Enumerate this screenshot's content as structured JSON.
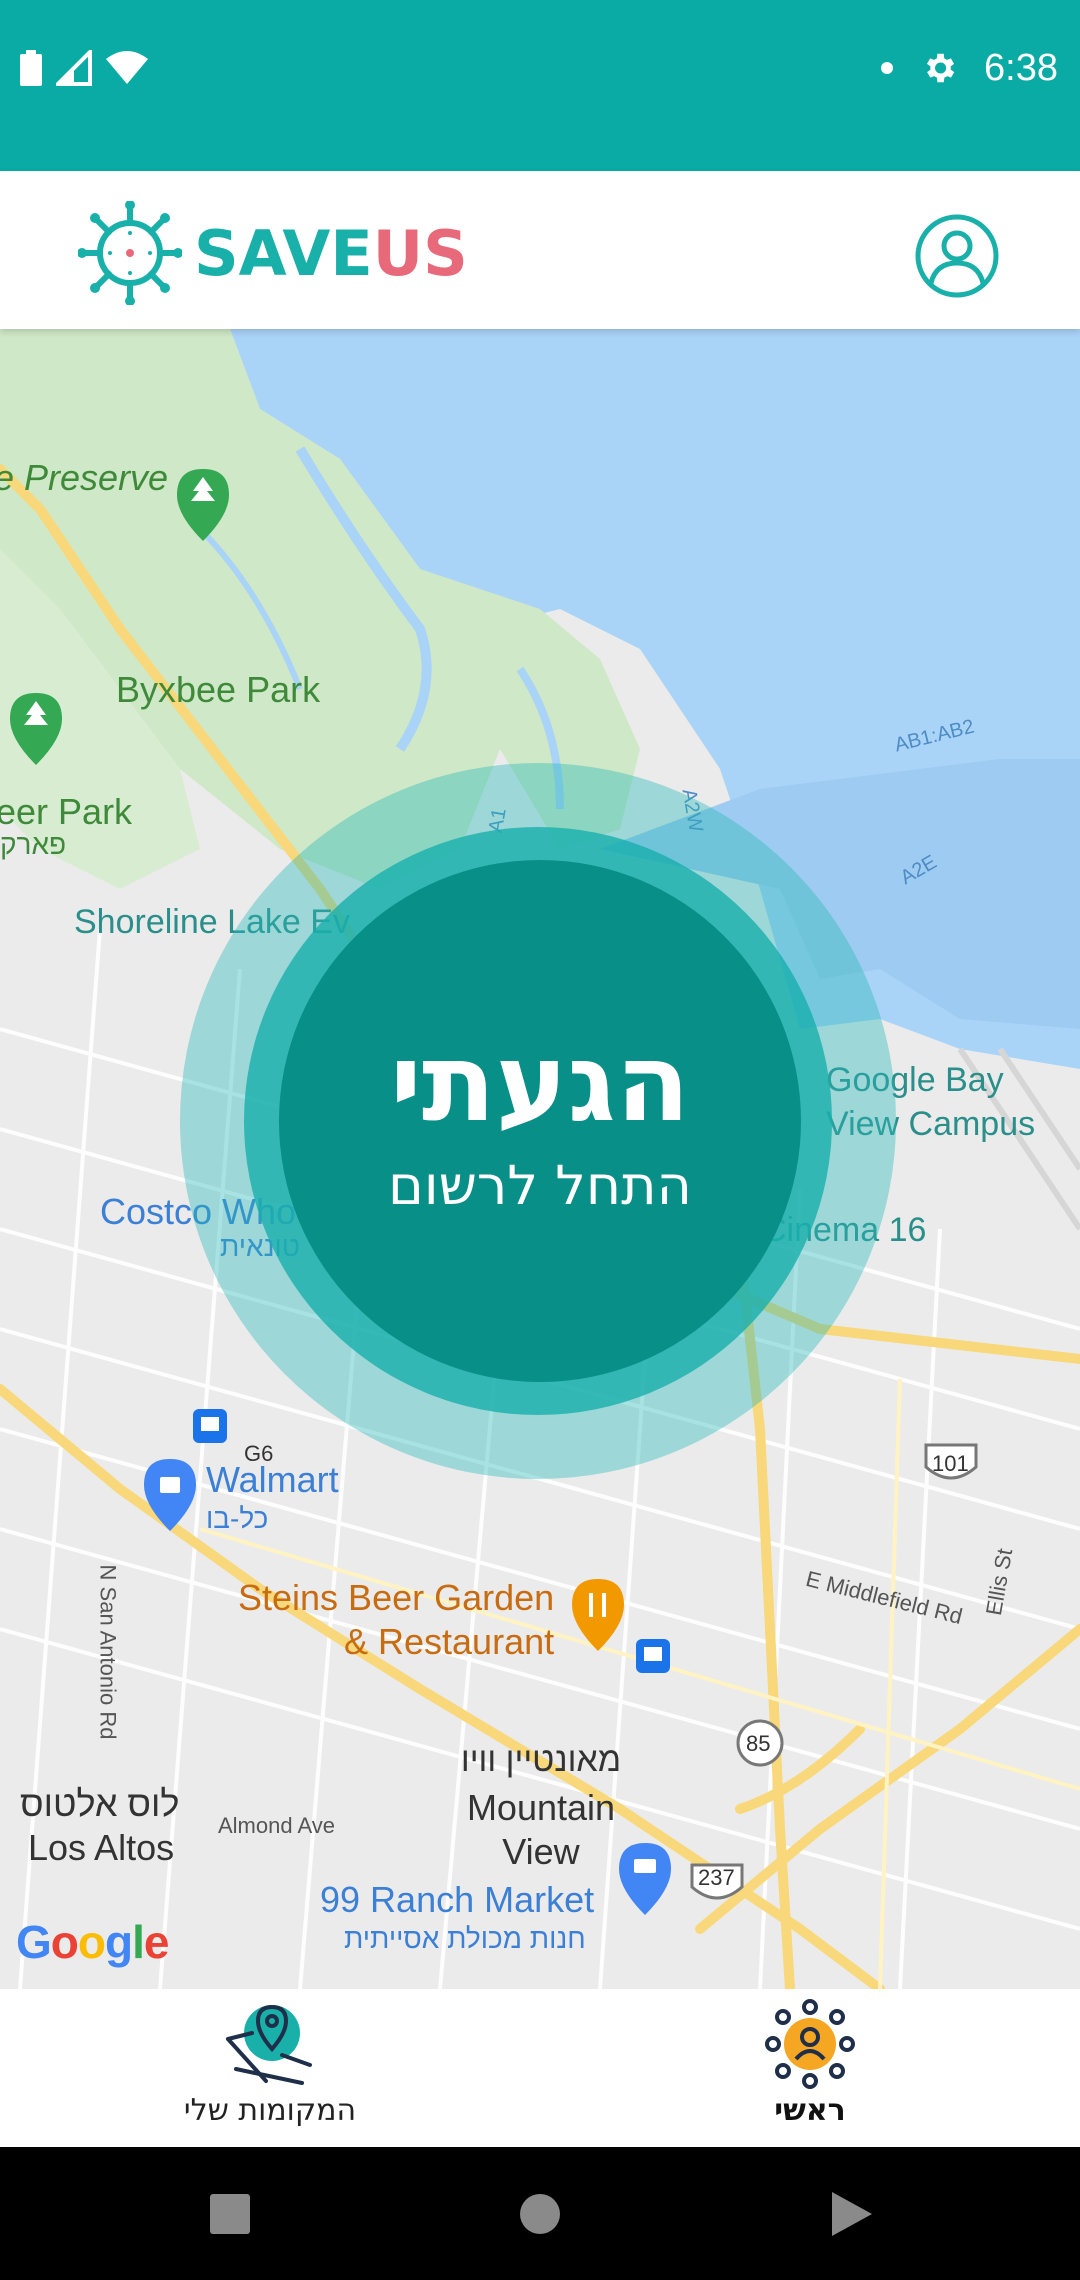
{
  "status_bar": {
    "time": "6:38",
    "icons": [
      "battery-icon",
      "signal-icon",
      "wifi-icon",
      "notification-dot-icon",
      "settings-icon"
    ]
  },
  "header": {
    "brand_part1": "SAVE",
    "brand_part2": "US",
    "logo_icon": "virus-icon",
    "profile_icon": "user-circle-icon"
  },
  "colors": {
    "primary": "#0aaba4",
    "brand_teal": "#1ab0aa",
    "brand_pink": "#e8697a",
    "button_fill": "#088f88",
    "accent_orange": "#f5a623"
  },
  "map": {
    "labels": {
      "preserve": "e Preserve",
      "byxbee": "Byxbee Park",
      "eer_park": "eer Park",
      "eer_park_he": "פארק",
      "shoreline": "Shoreline Lake Ev",
      "costco": "Costco Who",
      "costco_he": "טונאית",
      "google_bay_1": "Google Bay",
      "google_bay_2": "View Campus",
      "cinema": "Cinema 16",
      "walmart": "Walmart",
      "walmart_he": "כל-בו",
      "g6": "G6",
      "steins_1": "Steins Beer Garden",
      "steins_2": "& Restaurant",
      "mv_he": "מאונטיין וויו",
      "mv_1": "Mountain",
      "mv_2": "View",
      "los_altos_he": "לוס אלטוס",
      "los_altos": "Los Altos",
      "almond": "Almond Ave",
      "ranch": "99 Ranch Market",
      "ranch_he": "חנות מכולת אסייתית",
      "middlefield": "E Middlefield Rd",
      "ellis": "Ellis St",
      "antonio": "N San Antonio Rd",
      "ab1": "AB1:AB2",
      "a2e": "A2E",
      "a1": "A1",
      "a2w": "A2W",
      "hw101": "101",
      "hw85": "85",
      "hw237": "237",
      "google_logo": "Google"
    }
  },
  "arrive_button": {
    "title": "הגעתי",
    "subtitle": "התחל לרשום"
  },
  "bottom_nav": {
    "my_places": "המקומות שלי",
    "home": "ראשי"
  },
  "system_nav": [
    "recents-button",
    "home-button",
    "back-button"
  ]
}
